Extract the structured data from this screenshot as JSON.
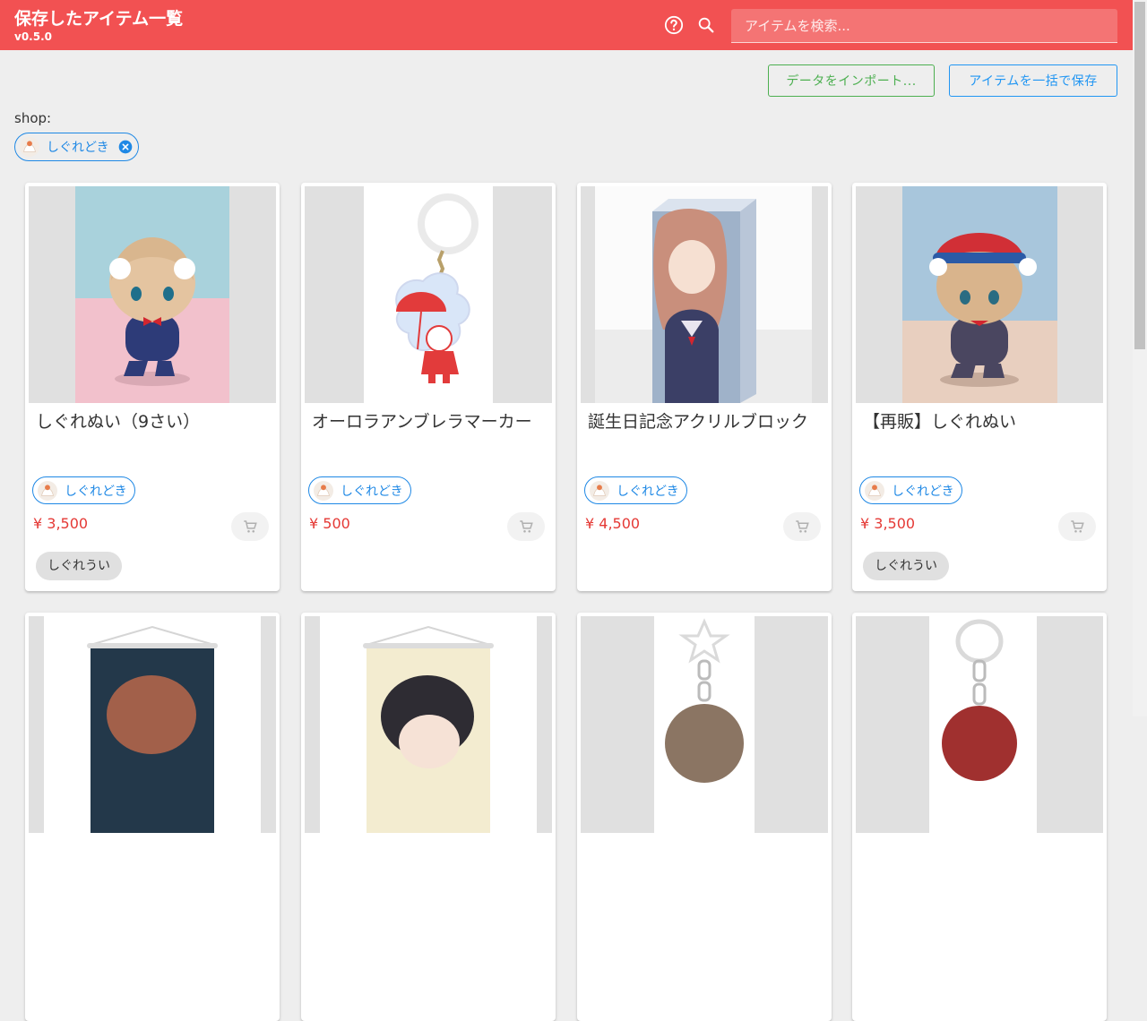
{
  "app": {
    "title": "保存したアイテム一覧",
    "version": "v0.5.0"
  },
  "search": {
    "placeholder": "アイテムを検索..."
  },
  "actions": {
    "import_label": "データをインポート...",
    "bulk_save_label": "アイテムを一括で保存"
  },
  "filter": {
    "label": "shop:",
    "chip": "しぐれどき"
  },
  "items": [
    {
      "name": "しぐれぬい（9さい）",
      "shop": "しぐれどき",
      "price": "¥ 3,500",
      "tag": "しぐれうい"
    },
    {
      "name": "オーロラアンブレラマーカー",
      "shop": "しぐれどき",
      "price": "¥ 500",
      "tag": ""
    },
    {
      "name": "誕生日記念アクリルブロック",
      "shop": "しぐれどき",
      "price": "¥ 4,500",
      "tag": ""
    },
    {
      "name": "【再販】しぐれぬい",
      "shop": "しぐれどき",
      "price": "¥ 3,500",
      "tag": "しぐれうい"
    }
  ],
  "icons": {
    "help": "help-circle-icon",
    "search": "search-icon",
    "close": "close-circle-icon",
    "cart": "cart-icon",
    "shop_avatar": "shop-avatar-icon"
  },
  "colors": {
    "appbar": "#f25152",
    "primary": "#1e88e5",
    "success": "#4caf50",
    "price": "#e53935"
  }
}
